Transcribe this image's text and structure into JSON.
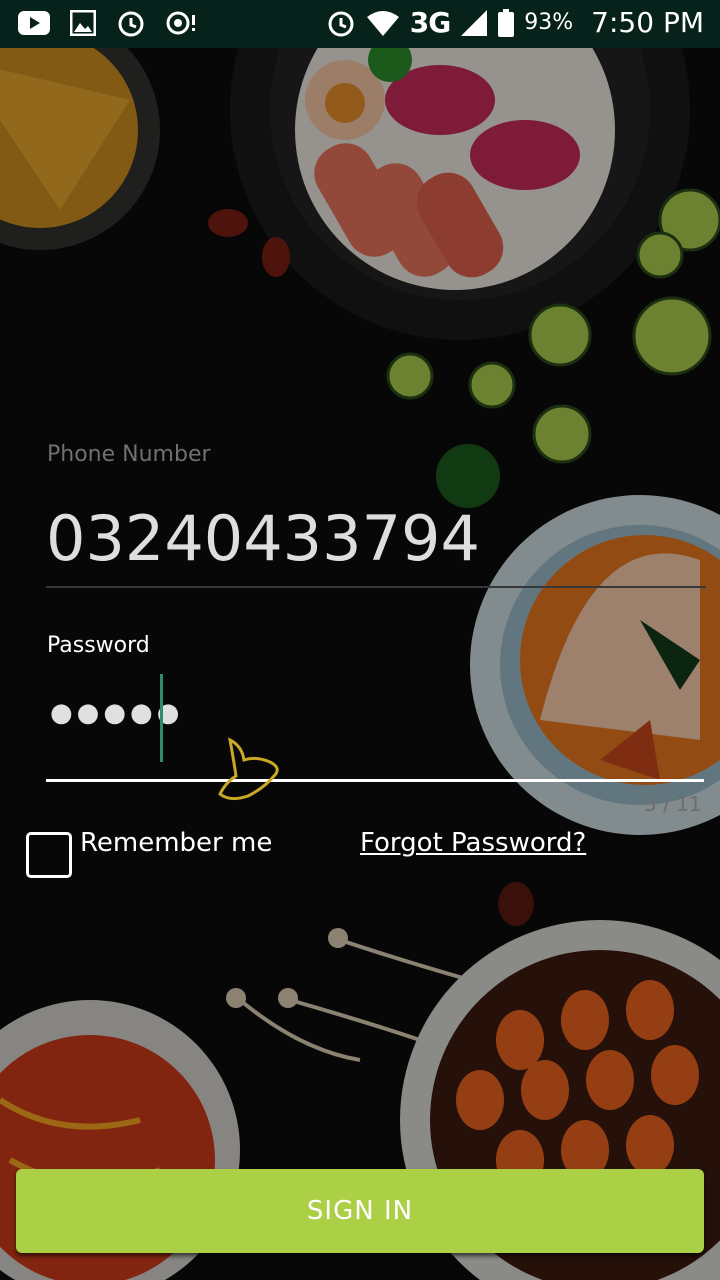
{
  "status_bar": {
    "left_icons": [
      "youtube-icon",
      "image-icon",
      "alarm-icon",
      "sync-icon"
    ],
    "right_icons": [
      "alarm-icon",
      "wifi-icon",
      "signal-icon",
      "battery-icon"
    ],
    "network": "3G",
    "battery": "93%",
    "time": "7:50 PM"
  },
  "login": {
    "phone_label": "Phone Number",
    "phone_value": "03240433794",
    "password_label": "Password",
    "password_mask": "●●●●●",
    "remember_label": "Remember me",
    "forgot_label": "Forgot Password?",
    "page_counter": "5 / 11",
    "signin_label": "SIGN IN"
  },
  "colors": {
    "accent": "#abd045",
    "status_bar": "#06221a",
    "background": "#0b0c0b"
  }
}
